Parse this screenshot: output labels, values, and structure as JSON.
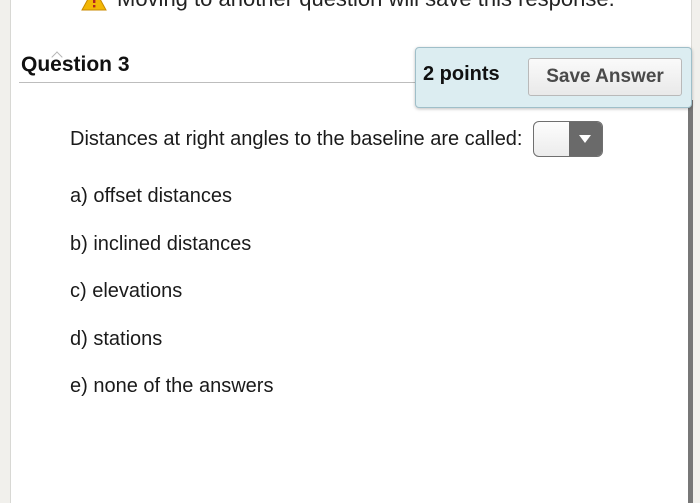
{
  "banner": {
    "text": "Moving to another question will save this response."
  },
  "question": {
    "title": "Question 3",
    "points": "2 points",
    "save_label": "Save Answer",
    "prompt": "Distances at right angles to the baseline are called:",
    "select_value": "",
    "options": [
      "a) offset distances",
      "b) inclined distances",
      "c) elevations",
      "d) stations",
      "e) none of the answers"
    ]
  },
  "icons": {
    "warning": "warning-icon",
    "dropdown": "chevron-down-icon"
  },
  "colors": {
    "points_panel_bg": "#dcedf1",
    "warning": "#f2b705"
  }
}
